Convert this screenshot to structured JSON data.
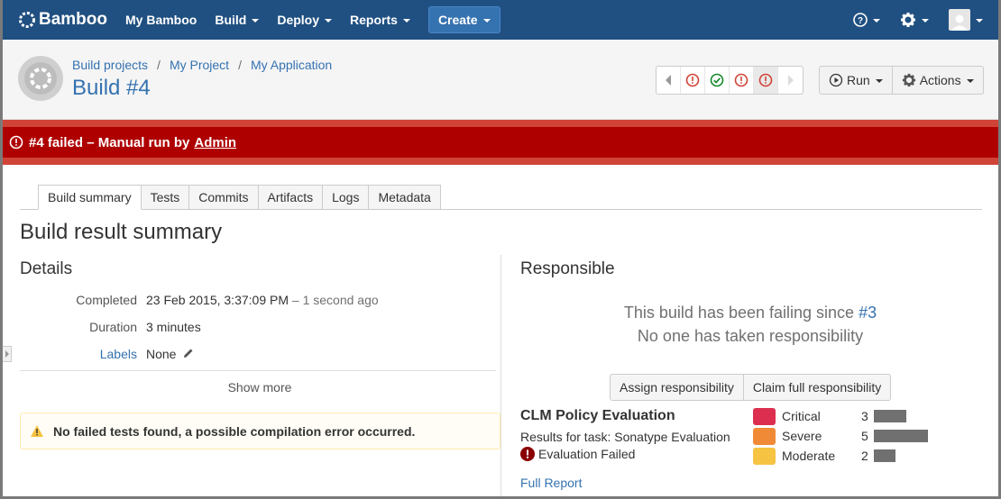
{
  "header": {
    "logo": "Bamboo",
    "nav": [
      {
        "label": "My Bamboo"
      },
      {
        "label": "Build"
      },
      {
        "label": "Deploy"
      },
      {
        "label": "Reports"
      }
    ],
    "create_label": "Create"
  },
  "breadcrumbs": [
    "Build projects",
    "My Project",
    "My Application"
  ],
  "page_title": "Build #4",
  "build_nav": [
    "failed",
    "successful",
    "failed",
    "failed"
  ],
  "actions": {
    "run_label": "Run",
    "actions_label": "Actions"
  },
  "banner": {
    "text": "#4 failed – Manual run by",
    "user": "Admin"
  },
  "tabs": [
    "Build summary",
    "Tests",
    "Commits",
    "Artifacts",
    "Logs",
    "Metadata"
  ],
  "section_title": "Build result summary",
  "details": {
    "heading": "Details",
    "completed_label": "Completed",
    "completed_value": "23 Feb 2015, 3:37:09 PM",
    "completed_ago": "– 1 second ago",
    "duration_label": "Duration",
    "duration_value": "3 minutes",
    "labels_label": "Labels",
    "labels_value": "None",
    "show_more": "Show more",
    "warning": "No failed tests found, a possible compilation error occurred."
  },
  "responsible": {
    "heading": "Responsible",
    "failing_since": "This build has been failing since",
    "failing_build": "#3",
    "no_one": "No one has taken responsibility",
    "assign_label": "Assign responsibility",
    "claim_label": "Claim full responsibility"
  },
  "clm": {
    "title": "CLM Policy Evaluation",
    "subtitle": "Results for task: Sonatype Evaluation",
    "status": "Evaluation Failed",
    "full_report": "Full Report",
    "severities": [
      {
        "name": "Critical",
        "count": 3,
        "color": "#dc2f4f"
      },
      {
        "name": "Severe",
        "count": 5,
        "color": "#f08a37"
      },
      {
        "name": "Moderate",
        "count": 2,
        "color": "#f6c342"
      }
    ]
  },
  "colors": {
    "brand": "#205081",
    "failed": "#af0000",
    "link": "#3572b0"
  }
}
